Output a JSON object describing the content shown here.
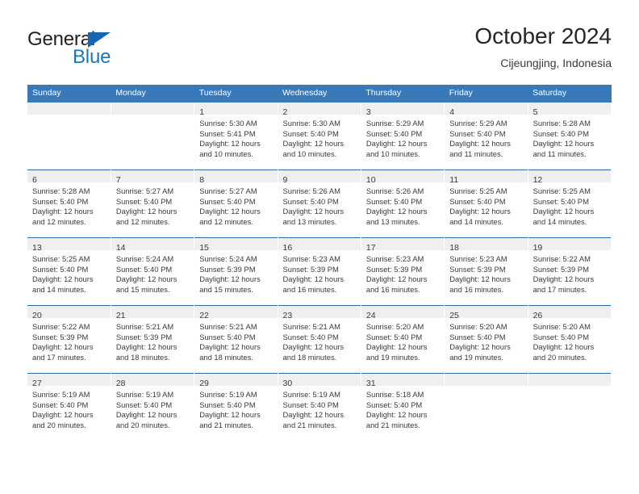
{
  "brand": {
    "name_part1": "General",
    "name_part2": "Blue",
    "triangle_color": "#1567b2",
    "blue_color": "#1b75bb"
  },
  "header": {
    "title": "October 2024",
    "location": "Cijeungjing, Indonesia"
  },
  "theme": {
    "header_bg": "#3a79b8",
    "row_separator": "#2e6ca8",
    "daynum_band_bg": "#efefef",
    "text": "#3a3a3a"
  },
  "weekdays": [
    "Sunday",
    "Monday",
    "Tuesday",
    "Wednesday",
    "Thursday",
    "Friday",
    "Saturday"
  ],
  "weeks": [
    [
      {
        "day": "",
        "sunrise": "",
        "sunset": "",
        "daylight1": "",
        "daylight2": ""
      },
      {
        "day": "",
        "sunrise": "",
        "sunset": "",
        "daylight1": "",
        "daylight2": ""
      },
      {
        "day": "1",
        "sunrise": "Sunrise: 5:30 AM",
        "sunset": "Sunset: 5:41 PM",
        "daylight1": "Daylight: 12 hours",
        "daylight2": "and 10 minutes."
      },
      {
        "day": "2",
        "sunrise": "Sunrise: 5:30 AM",
        "sunset": "Sunset: 5:40 PM",
        "daylight1": "Daylight: 12 hours",
        "daylight2": "and 10 minutes."
      },
      {
        "day": "3",
        "sunrise": "Sunrise: 5:29 AM",
        "sunset": "Sunset: 5:40 PM",
        "daylight1": "Daylight: 12 hours",
        "daylight2": "and 10 minutes."
      },
      {
        "day": "4",
        "sunrise": "Sunrise: 5:29 AM",
        "sunset": "Sunset: 5:40 PM",
        "daylight1": "Daylight: 12 hours",
        "daylight2": "and 11 minutes."
      },
      {
        "day": "5",
        "sunrise": "Sunrise: 5:28 AM",
        "sunset": "Sunset: 5:40 PM",
        "daylight1": "Daylight: 12 hours",
        "daylight2": "and 11 minutes."
      }
    ],
    [
      {
        "day": "6",
        "sunrise": "Sunrise: 5:28 AM",
        "sunset": "Sunset: 5:40 PM",
        "daylight1": "Daylight: 12 hours",
        "daylight2": "and 12 minutes."
      },
      {
        "day": "7",
        "sunrise": "Sunrise: 5:27 AM",
        "sunset": "Sunset: 5:40 PM",
        "daylight1": "Daylight: 12 hours",
        "daylight2": "and 12 minutes."
      },
      {
        "day": "8",
        "sunrise": "Sunrise: 5:27 AM",
        "sunset": "Sunset: 5:40 PM",
        "daylight1": "Daylight: 12 hours",
        "daylight2": "and 12 minutes."
      },
      {
        "day": "9",
        "sunrise": "Sunrise: 5:26 AM",
        "sunset": "Sunset: 5:40 PM",
        "daylight1": "Daylight: 12 hours",
        "daylight2": "and 13 minutes."
      },
      {
        "day": "10",
        "sunrise": "Sunrise: 5:26 AM",
        "sunset": "Sunset: 5:40 PM",
        "daylight1": "Daylight: 12 hours",
        "daylight2": "and 13 minutes."
      },
      {
        "day": "11",
        "sunrise": "Sunrise: 5:25 AM",
        "sunset": "Sunset: 5:40 PM",
        "daylight1": "Daylight: 12 hours",
        "daylight2": "and 14 minutes."
      },
      {
        "day": "12",
        "sunrise": "Sunrise: 5:25 AM",
        "sunset": "Sunset: 5:40 PM",
        "daylight1": "Daylight: 12 hours",
        "daylight2": "and 14 minutes."
      }
    ],
    [
      {
        "day": "13",
        "sunrise": "Sunrise: 5:25 AM",
        "sunset": "Sunset: 5:40 PM",
        "daylight1": "Daylight: 12 hours",
        "daylight2": "and 14 minutes."
      },
      {
        "day": "14",
        "sunrise": "Sunrise: 5:24 AM",
        "sunset": "Sunset: 5:40 PM",
        "daylight1": "Daylight: 12 hours",
        "daylight2": "and 15 minutes."
      },
      {
        "day": "15",
        "sunrise": "Sunrise: 5:24 AM",
        "sunset": "Sunset: 5:39 PM",
        "daylight1": "Daylight: 12 hours",
        "daylight2": "and 15 minutes."
      },
      {
        "day": "16",
        "sunrise": "Sunrise: 5:23 AM",
        "sunset": "Sunset: 5:39 PM",
        "daylight1": "Daylight: 12 hours",
        "daylight2": "and 16 minutes."
      },
      {
        "day": "17",
        "sunrise": "Sunrise: 5:23 AM",
        "sunset": "Sunset: 5:39 PM",
        "daylight1": "Daylight: 12 hours",
        "daylight2": "and 16 minutes."
      },
      {
        "day": "18",
        "sunrise": "Sunrise: 5:23 AM",
        "sunset": "Sunset: 5:39 PM",
        "daylight1": "Daylight: 12 hours",
        "daylight2": "and 16 minutes."
      },
      {
        "day": "19",
        "sunrise": "Sunrise: 5:22 AM",
        "sunset": "Sunset: 5:39 PM",
        "daylight1": "Daylight: 12 hours",
        "daylight2": "and 17 minutes."
      }
    ],
    [
      {
        "day": "20",
        "sunrise": "Sunrise: 5:22 AM",
        "sunset": "Sunset: 5:39 PM",
        "daylight1": "Daylight: 12 hours",
        "daylight2": "and 17 minutes."
      },
      {
        "day": "21",
        "sunrise": "Sunrise: 5:21 AM",
        "sunset": "Sunset: 5:39 PM",
        "daylight1": "Daylight: 12 hours",
        "daylight2": "and 18 minutes."
      },
      {
        "day": "22",
        "sunrise": "Sunrise: 5:21 AM",
        "sunset": "Sunset: 5:40 PM",
        "daylight1": "Daylight: 12 hours",
        "daylight2": "and 18 minutes."
      },
      {
        "day": "23",
        "sunrise": "Sunrise: 5:21 AM",
        "sunset": "Sunset: 5:40 PM",
        "daylight1": "Daylight: 12 hours",
        "daylight2": "and 18 minutes."
      },
      {
        "day": "24",
        "sunrise": "Sunrise: 5:20 AM",
        "sunset": "Sunset: 5:40 PM",
        "daylight1": "Daylight: 12 hours",
        "daylight2": "and 19 minutes."
      },
      {
        "day": "25",
        "sunrise": "Sunrise: 5:20 AM",
        "sunset": "Sunset: 5:40 PM",
        "daylight1": "Daylight: 12 hours",
        "daylight2": "and 19 minutes."
      },
      {
        "day": "26",
        "sunrise": "Sunrise: 5:20 AM",
        "sunset": "Sunset: 5:40 PM",
        "daylight1": "Daylight: 12 hours",
        "daylight2": "and 20 minutes."
      }
    ],
    [
      {
        "day": "27",
        "sunrise": "Sunrise: 5:19 AM",
        "sunset": "Sunset: 5:40 PM",
        "daylight1": "Daylight: 12 hours",
        "daylight2": "and 20 minutes."
      },
      {
        "day": "28",
        "sunrise": "Sunrise: 5:19 AM",
        "sunset": "Sunset: 5:40 PM",
        "daylight1": "Daylight: 12 hours",
        "daylight2": "and 20 minutes."
      },
      {
        "day": "29",
        "sunrise": "Sunrise: 5:19 AM",
        "sunset": "Sunset: 5:40 PM",
        "daylight1": "Daylight: 12 hours",
        "daylight2": "and 21 minutes."
      },
      {
        "day": "30",
        "sunrise": "Sunrise: 5:19 AM",
        "sunset": "Sunset: 5:40 PM",
        "daylight1": "Daylight: 12 hours",
        "daylight2": "and 21 minutes."
      },
      {
        "day": "31",
        "sunrise": "Sunrise: 5:18 AM",
        "sunset": "Sunset: 5:40 PM",
        "daylight1": "Daylight: 12 hours",
        "daylight2": "and 21 minutes."
      },
      {
        "day": "",
        "sunrise": "",
        "sunset": "",
        "daylight1": "",
        "daylight2": ""
      },
      {
        "day": "",
        "sunrise": "",
        "sunset": "",
        "daylight1": "",
        "daylight2": ""
      }
    ]
  ]
}
